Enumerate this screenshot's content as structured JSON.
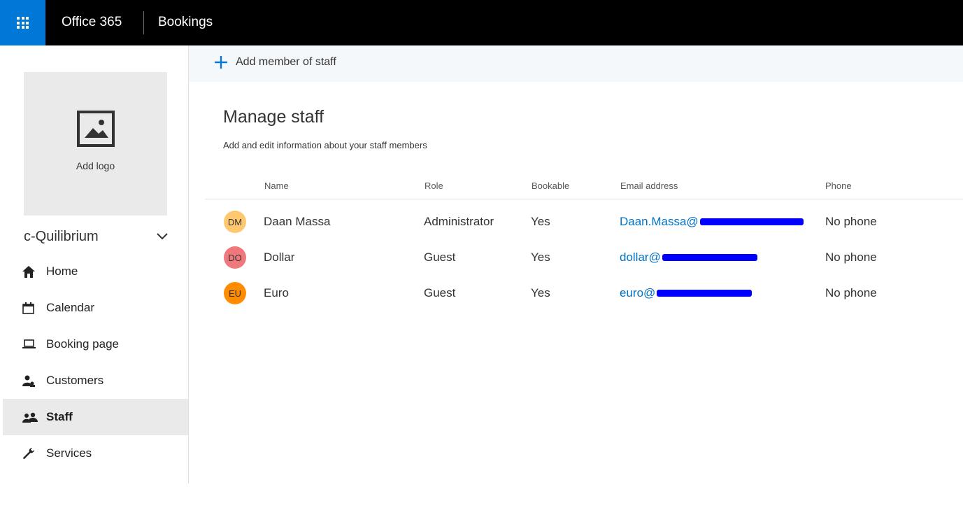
{
  "header": {
    "brand": "Office 365",
    "app_name": "Bookings",
    "accent": "#0078d7"
  },
  "sidebar": {
    "logo_label": "Add logo",
    "business_name": "c-Quilibrium",
    "items": [
      {
        "label": "Home",
        "icon": "home-icon"
      },
      {
        "label": "Calendar",
        "icon": "calendar-icon"
      },
      {
        "label": "Booking page",
        "icon": "laptop-icon"
      },
      {
        "label": "Customers",
        "icon": "customers-icon"
      },
      {
        "label": "Staff",
        "icon": "staff-icon",
        "active": true
      },
      {
        "label": "Services",
        "icon": "wrench-icon"
      }
    ]
  },
  "toolbar": {
    "add_staff_label": "Add member of staff"
  },
  "main": {
    "title": "Manage staff",
    "subtitle": "Add and edit information about your staff members",
    "columns": [
      "Name",
      "Role",
      "Bookable",
      "Email address",
      "Phone"
    ],
    "staff": [
      {
        "initials": "DM",
        "avatar_color": "#ffc86e",
        "name": "Daan Massa",
        "role": "Administrator",
        "bookable": "Yes",
        "email": "Daan.Massa@",
        "phone": "No phone"
      },
      {
        "initials": "DO",
        "avatar_color": "#f0787d",
        "name": "Dollar",
        "role": "Guest",
        "bookable": "Yes",
        "email": "dollar@",
        "phone": "No phone"
      },
      {
        "initials": "EU",
        "avatar_color": "#ff8c00",
        "name": "Euro",
        "role": "Guest",
        "bookable": "Yes",
        "email": "euro@",
        "phone": "No phone"
      }
    ]
  }
}
